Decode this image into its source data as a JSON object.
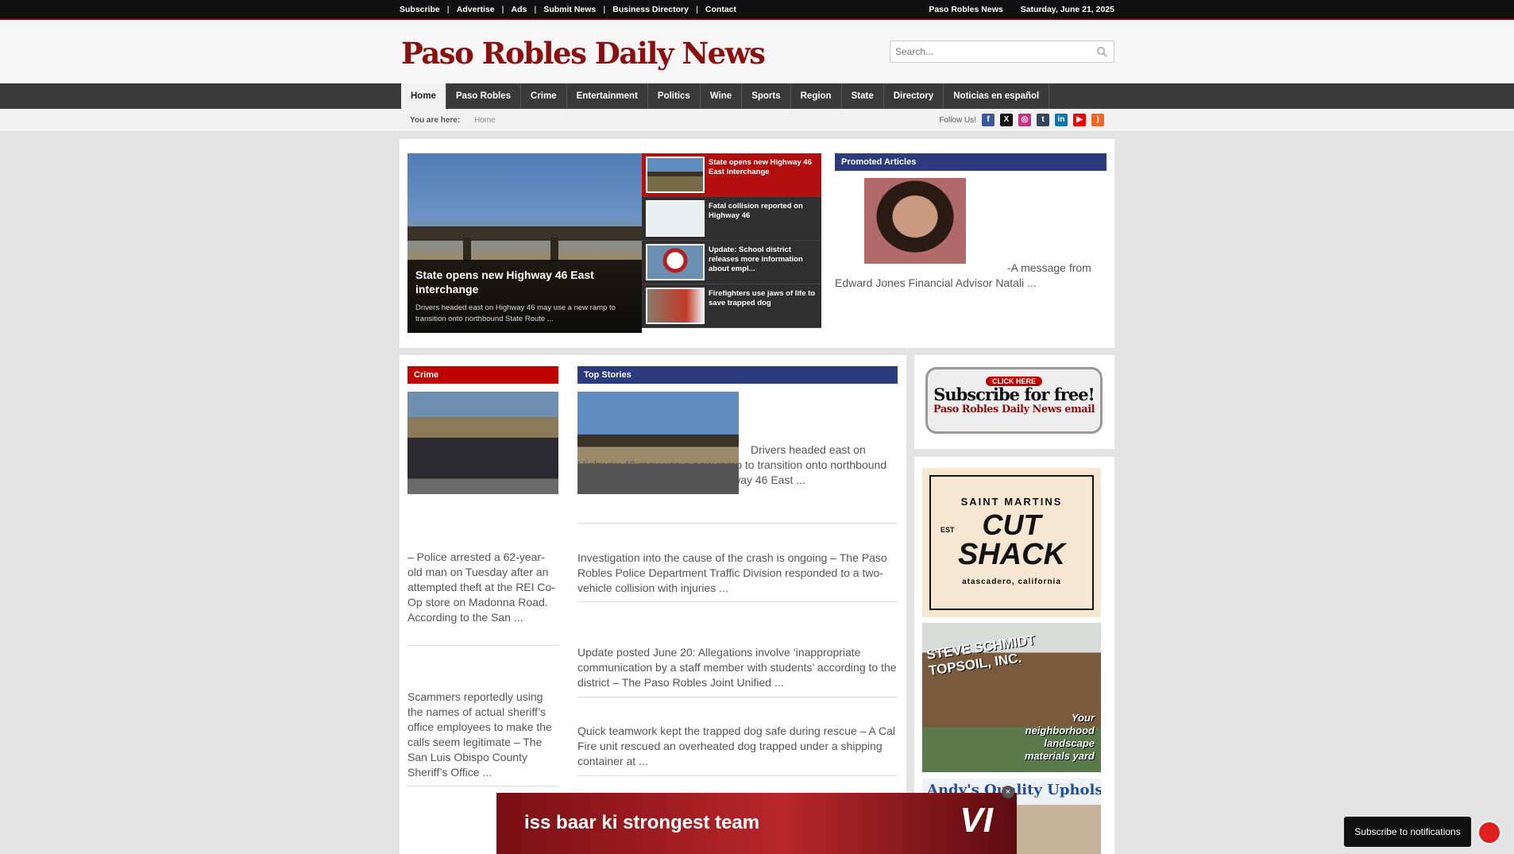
{
  "topbar": {
    "links": [
      "Subscribe",
      "Advertise",
      "Ads",
      "Submit News",
      "Business Directory",
      "Contact"
    ],
    "site": "Paso Robles News",
    "date": "Saturday, June 21, 2025"
  },
  "header": {
    "logo": "Paso Robles Daily News",
    "search_placeholder": "Search..."
  },
  "nav": [
    "Home",
    "Paso Robles",
    "Crime",
    "Entertainment",
    "Politics",
    "Wine",
    "Sports",
    "Region",
    "State",
    "Directory",
    "Noticias en español"
  ],
  "breadcrumb": {
    "label": "You are here:",
    "current": "Home"
  },
  "follow": {
    "label": "Follow Us!",
    "icons": [
      "facebook-icon",
      "x-icon",
      "instagram-icon",
      "tumblr-icon",
      "linkedin-icon",
      "youtube-icon",
      "rss-icon"
    ]
  },
  "hero": {
    "title": "State opens new Highway 46 East interchange",
    "desc": "Drivers headed east on Highway 46 may use a new ramp to transition onto northbound State Route ..."
  },
  "featured": [
    "State opens new Highway 46 East interchange",
    "Fatal collision reported on Highway 46",
    "Update: School district releases more information about empl...",
    "Firefighters use jaws of life to save trapped dog"
  ],
  "promoted": {
    "heading": "Promoted Articles",
    "text": "-A message from Edward Jones Financial Advisor Natali ..."
  },
  "crime": {
    "heading": "Crime",
    "items": [
      "– Police arrested a 62-year-old man on Tuesday after an attempted theft at the REI Co-Op store on Madonna Road. According to the San ...",
      "Scammers reportedly using the names of actual sheriff’s office employees to make the calls seem legitimate – The San Luis Obispo County Sheriff’s Office ..."
    ]
  },
  "top_stories": {
    "heading": "Top Stories",
    "items": [
      "Drivers headed east on Highway 46 may use a new ramp to transition onto northbound State Route 41 – The new Highway 46 East ...",
      "Investigation into the cause of the crash is ongoing – The Paso Robles Police Department Traffic Division responded to a two-vehicle collision with injuries ...",
      "Update posted June 20: Allegations involve ‘inappropriate communication by a staff member with students’ according to the district – The Paso Robles Joint Unified ...",
      "Quick teamwork kept the trapped dog safe during rescue – A Cal Fire unit rescued an overheated dog trapped under a shipping container at ..."
    ]
  },
  "ads": {
    "subscribe": {
      "click": "CLICK HERE",
      "title": "Subscribe for free!",
      "sub": "Paso Robles Daily News email"
    },
    "cutshack": {
      "top": "SAINT MARTINS",
      "est": "EST",
      "main1": "CUT",
      "main2": "SHACK",
      "sub": "atascadero, california"
    },
    "topsoil": {
      "title": "STEVE SCHMIDT TOPSOIL, INC.",
      "tag": "Your neighborhood landscape materials yard"
    },
    "andys": "Andy's Quality Upholstery",
    "banner": "iss baar ki strongest team",
    "banner_logo": "VI"
  },
  "notifications": "Subscribe to notifications",
  "colors": {
    "crime": "#c00000",
    "top_stories": "#2b3b7d",
    "nav": "#3a3a3a",
    "logo": "#8b0f0f"
  }
}
